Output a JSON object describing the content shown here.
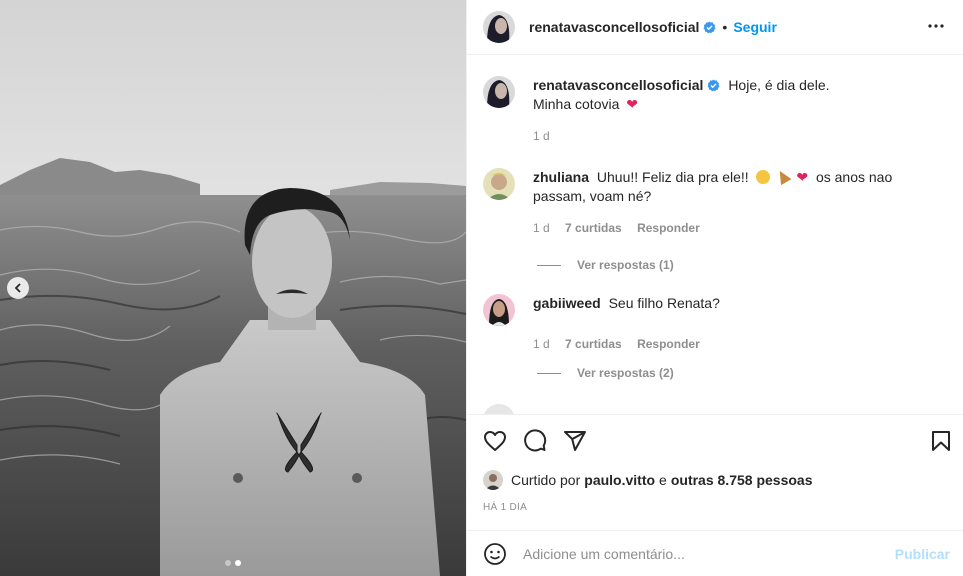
{
  "post": {
    "author": "renatavasconcellosoficial",
    "follow_label": "Seguir",
    "separator": "•",
    "caption_line1": "Hoje, é dia dele.",
    "caption_line2": "Minha cotovia",
    "caption_time": "1 d"
  },
  "comments": [
    {
      "user": "zhuliana",
      "text_start": "Uhuu!! Feliz dia pra ele!!",
      "text_end": "os anos nao passam, voam né?",
      "time": "1 d",
      "likes": "7 curtidas",
      "reply_label": "Responder",
      "view_replies": "Ver respostas (1)"
    },
    {
      "user": "gabiiweed",
      "text": "Seu filho Renata?",
      "time": "1 d",
      "likes": "7 curtidas",
      "reply_label": "Responder",
      "view_replies": "Ver respostas (2)"
    }
  ],
  "likes": {
    "prefix": "Curtido por",
    "user": "paulo.vitto",
    "middle": "e",
    "rest": "outras 8.758 pessoas"
  },
  "date_label": "HÁ 1 DIA",
  "add_comment": {
    "placeholder": "Adicione um comentário...",
    "publish_label": "Publicar"
  },
  "carousel": {
    "count": 2,
    "active_index": 1
  },
  "colors": {
    "accent": "#0095f6",
    "publish_disabled": "#b2dffc",
    "heart": "#ed4956",
    "verified": "#3897f0",
    "muted": "#8e8e8e"
  },
  "icons": [
    "heart-icon",
    "comment-icon",
    "share-icon",
    "save-icon",
    "more-icon",
    "emoji-icon",
    "verified-icon",
    "chevron-left-icon"
  ]
}
